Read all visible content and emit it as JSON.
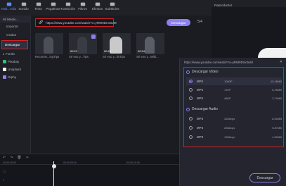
{
  "toolbar": {
    "items": [
      {
        "label": "Mult...edia",
        "icon": "folder-icon"
      },
      {
        "label": "Sonido",
        "icon": "music-note-icon"
      },
      {
        "label": "Texto",
        "icon": "text-icon"
      },
      {
        "label": "Pegatinas",
        "icon": "sticker-icon"
      },
      {
        "label": "Transición",
        "icon": "transition-icon"
      },
      {
        "label": "Filtros",
        "icon": "filter-icon"
      },
      {
        "label": "Efectos",
        "icon": "effects-icon"
      },
      {
        "label": "Subtitulos",
        "icon": "subtitles-icon"
      }
    ],
    "reproductor": "Reproductor"
  },
  "sidebar": {
    "header": "Mi Medio...",
    "items": [
      "Importar",
      "Grabar",
      "Descargar"
    ],
    "categories": [
      {
        "label": "Fondo",
        "color": "#aeb2be"
      },
      {
        "label": "Pixabay",
        "color": "#2ec66e"
      },
      {
        "label": "Unsplash",
        "color": "#ffffff"
      },
      {
        "label": "Giphy",
        "color": "#8c7ff0"
      }
    ]
  },
  "media": {
    "url": "https://www.youtube.com/watch?v=yRW9Dmc5vM",
    "download_label": "Descargar",
    "count": "5/4",
    "clips": [
      {
        "caption": "Recomie...ingTips",
        "duration": ""
      },
      {
        "caption": "Sé eso y...Tips",
        "duration": "00:21"
      },
      {
        "caption": "Sé eso y...ilsTips",
        "duration": "00:23"
      },
      {
        "caption": "Sé eso y...Wiki...",
        "duration": "00:24"
      }
    ]
  },
  "dialog": {
    "url": "https://www.youtube.com/watch?v=yRW9Dmc5vM",
    "video_title": "Descargar Vídeo",
    "audio_title": "Descargar Audio",
    "video_rows": [
      {
        "format": "MP4",
        "quality": "1080P",
        "size": "15.28MB"
      },
      {
        "format": "MP4",
        "quality": "720P",
        "size": "6.25MB"
      },
      {
        "format": "MP4",
        "quality": "480P",
        "size": "3.70MB"
      }
    ],
    "audio_rows": [
      {
        "format": "MP3",
        "quality": "320kbps",
        "size": "8.50MB"
      },
      {
        "format": "MP3",
        "quality": "256kbps",
        "size": "5.87MB"
      },
      {
        "format": "MP3",
        "quality": "128kbps",
        "size": "4.59MB"
      }
    ],
    "button": "Descargar"
  },
  "timeline": {
    "ticks": [
      "00:00:00:00",
      "00:00:05:00",
      "00:00:10:00"
    ]
  }
}
